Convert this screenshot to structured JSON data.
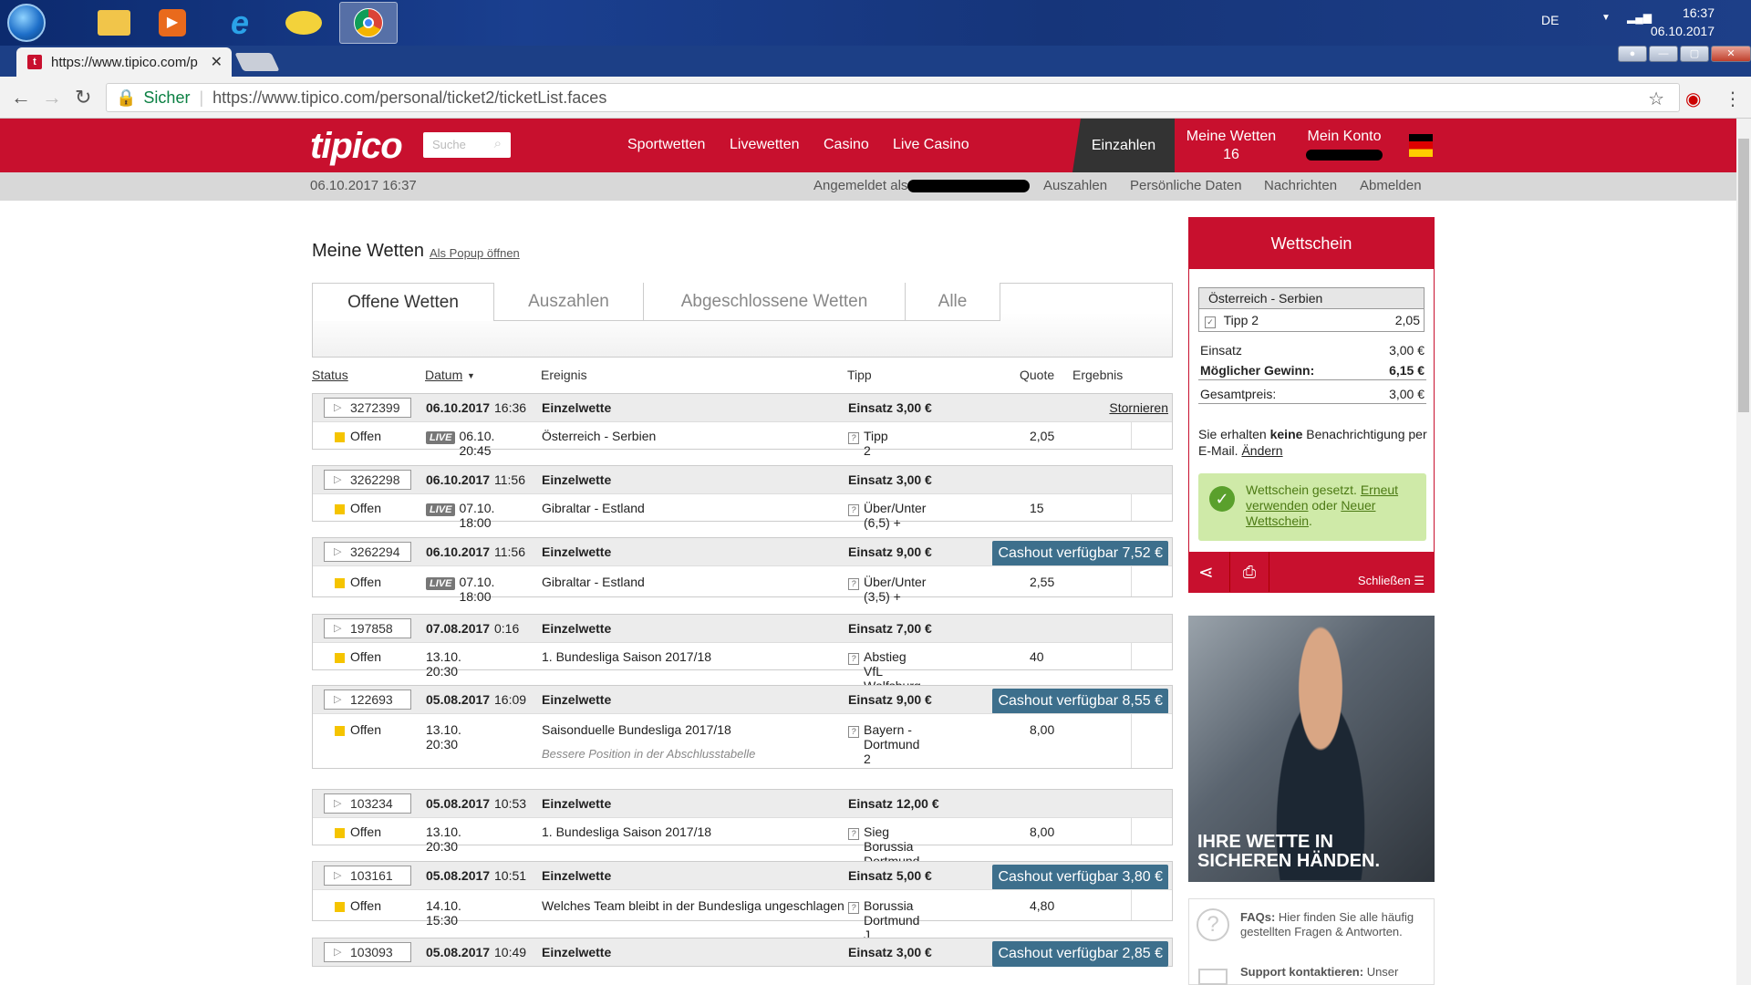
{
  "taskbar": {
    "lang": "DE",
    "time": "16:37",
    "date": "06.10.2017"
  },
  "browser": {
    "tab_title": "https://www.tipico.com/p",
    "secure_label": "Sicher",
    "url": "https://www.tipico.com/personal/ticket2/ticketList.faces"
  },
  "header": {
    "logo": "tipico",
    "search_placeholder": "Suche",
    "nav": [
      "Sportwetten",
      "Livewetten",
      "Casino",
      "Live Casino"
    ],
    "einzahlen": "Einzahlen",
    "meine_wetten": "Meine Wetten",
    "meine_wetten_count": "16",
    "mein_konto": "Mein Konto"
  },
  "subheader": {
    "datetime": "06.10.2017  16:37",
    "angemeldet": "Angemeldet als",
    "links": [
      "Auszahlen",
      "Persönliche Daten",
      "Nachrichten",
      "Abmelden"
    ]
  },
  "main": {
    "title": "Meine Wetten",
    "popup_link": "Als Popup öffnen",
    "tabs": [
      "Offene Wetten",
      "Auszahlen",
      "Abgeschlossene Wetten",
      "Alle"
    ],
    "columns": [
      "Status",
      "Datum",
      "Ereignis",
      "Tipp",
      "Quote",
      "Ergebnis"
    ],
    "bets": [
      {
        "id": "3272399",
        "date": "06.10.2017",
        "time": "16:36",
        "type": "Einzelwette",
        "einsatz": "Einsatz 3,00 €",
        "action": "Stornieren",
        "cashout": "",
        "status": "Offen",
        "live": true,
        "event_time": "06.10. 20:45",
        "event": "Österreich - Serbien",
        "tipp": "Tipp 2",
        "quote": "2,05",
        "note": ""
      },
      {
        "id": "3262298",
        "date": "06.10.2017",
        "time": "11:56",
        "type": "Einzelwette",
        "einsatz": "Einsatz 3,00 €",
        "action": "",
        "cashout": "",
        "status": "Offen",
        "live": true,
        "event_time": "07.10. 18:00",
        "event": "Gibraltar - Estland",
        "tipp": "Über/Unter (6,5) +",
        "quote": "15",
        "note": ""
      },
      {
        "id": "3262294",
        "date": "06.10.2017",
        "time": "11:56",
        "type": "Einzelwette",
        "einsatz": "Einsatz 9,00 €",
        "action": "",
        "cashout": "Cashout verfügbar 7,52 €",
        "status": "Offen",
        "live": true,
        "event_time": "07.10. 18:00",
        "event": "Gibraltar - Estland",
        "tipp": "Über/Unter (3,5) +",
        "quote": "2,55",
        "note": ""
      },
      {
        "id": "197858",
        "date": "07.08.2017",
        "time": "0:16",
        "type": "Einzelwette",
        "einsatz": "Einsatz 7,00 €",
        "action": "",
        "cashout": "",
        "status": "Offen",
        "live": false,
        "event_time": "13.10. 20:30",
        "event": "1. Bundesliga Saison 2017/18",
        "tipp": "Abstieg VfL Wolfsburg",
        "quote": "40",
        "note": ""
      },
      {
        "id": "122693",
        "date": "05.08.2017",
        "time": "16:09",
        "type": "Einzelwette",
        "einsatz": "Einsatz 9,00 €",
        "action": "",
        "cashout": "Cashout verfügbar 8,55 €",
        "status": "Offen",
        "live": false,
        "event_time": "13.10. 20:30",
        "event": "Saisonduelle Bundesliga 2017/18",
        "tipp": "Bayern - Dortmund  2",
        "quote": "8,00",
        "note": "Bessere Position in der Abschlusstabelle"
      },
      {
        "id": "103234",
        "date": "05.08.2017",
        "time": "10:53",
        "type": "Einzelwette",
        "einsatz": "Einsatz 12,00 €",
        "action": "",
        "cashout": "",
        "status": "Offen",
        "live": false,
        "event_time": "13.10. 20:30",
        "event": "1. Bundesliga Saison 2017/18",
        "tipp": "Sieg Borussia Dortmund",
        "quote": "8,00",
        "note": ""
      },
      {
        "id": "103161",
        "date": "05.08.2017",
        "time": "10:51",
        "type": "Einzelwette",
        "einsatz": "Einsatz 5,00 €",
        "action": "",
        "cashout": "Cashout verfügbar 3,80 €",
        "status": "Offen",
        "live": false,
        "event_time": "14.10. 15:30",
        "event": "Welches Team bleibt in der Bundesliga ungeschlagen g",
        "tipp": "Borussia Dortmund  J",
        "quote": "4,80",
        "note": ""
      },
      {
        "id": "103093",
        "date": "05.08.2017",
        "time": "10:49",
        "type": "Einzelwette",
        "einsatz": "Einsatz 3,00 €",
        "action": "",
        "cashout": "Cashout verfügbar 2,85 €",
        "status": "",
        "live": false,
        "event_time": "",
        "event": "",
        "tipp": "",
        "quote": "",
        "note": ""
      }
    ]
  },
  "wettschein": {
    "title": "Wettschein",
    "match": "Österreich - Serbien",
    "tipp": "Tipp 2",
    "tipp_quote": "2,05",
    "einsatz_label": "Einsatz",
    "einsatz_value": "3,00 €",
    "gewinn_label": "Möglicher Gewinn:",
    "gewinn_value": "6,15 €",
    "gesamt_label": "Gesamtpreis:",
    "gesamt_value": "3,00 €",
    "info_pre": "Sie erhalten ",
    "info_bold": "keine",
    "info_post": " Benachrichtigung per E-Mail. ",
    "info_link": "Ändern",
    "ok_text": "Wettschein gesetzt. ",
    "ok_link1": "Erneut verwenden",
    "ok_mid": " oder ",
    "ok_link2": "Neuer Wettschein",
    "ok_end": ".",
    "close": "Schließen"
  },
  "ad": {
    "line1": "IHRE WETTE IN",
    "line2": "SICHEREN HÄNDEN."
  },
  "faq": {
    "faq_bold": "FAQs:",
    "faq_text": " Hier finden Sie alle häufig gestellten Fragen & Antworten.",
    "support_bold": "Support kontaktieren:",
    "support_text": " Unser"
  },
  "colors": {
    "brand_red": "#c8102e",
    "cashout_blue": "#3d6f8c",
    "status_yellow": "#f5c400"
  }
}
